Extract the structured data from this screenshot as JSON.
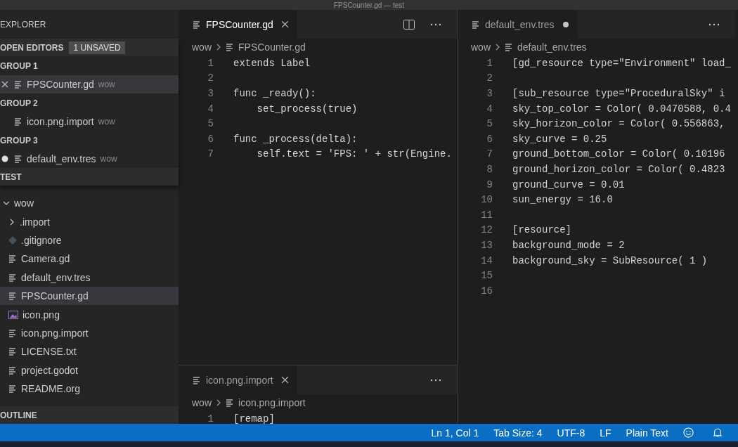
{
  "window": {
    "title": "FPSCounter.gd — test"
  },
  "sidebar": {
    "title": "EXPLORER",
    "open_editors": {
      "title": "OPEN EDITORS",
      "badge": "1 UNSAVED",
      "groups": [
        {
          "title": "GROUP 1",
          "items": [
            {
              "name": "FPSCounter.gd",
              "folder": "wow",
              "close_shown": true,
              "dirty": false,
              "selected": true
            }
          ]
        },
        {
          "title": "GROUP 2",
          "items": [
            {
              "name": "icon.png.import",
              "folder": "wow",
              "close_shown": false,
              "dirty": false,
              "selected": false
            }
          ]
        },
        {
          "title": "GROUP 3",
          "items": [
            {
              "name": "default_env.tres",
              "folder": "wow",
              "close_shown": false,
              "dirty": true,
              "selected": false
            }
          ]
        }
      ]
    },
    "folder_title": "TEST",
    "tree": [
      {
        "name": "wow",
        "kind": "folder",
        "expanded": true,
        "selected": false,
        "children": [
          {
            "name": ".import",
            "kind": "folder",
            "expanded": false,
            "selected": false
          },
          {
            "name": ".gitignore",
            "kind": "git",
            "selected": false
          },
          {
            "name": "Camera.gd",
            "kind": "file",
            "selected": false
          },
          {
            "name": "default_env.tres",
            "kind": "file",
            "selected": false
          },
          {
            "name": "FPSCounter.gd",
            "kind": "file",
            "selected": true
          },
          {
            "name": "icon.png",
            "kind": "image",
            "selected": false
          },
          {
            "name": "icon.png.import",
            "kind": "file",
            "selected": false
          },
          {
            "name": "LICENSE.txt",
            "kind": "file",
            "selected": false
          },
          {
            "name": "project.godot",
            "kind": "file",
            "selected": false
          },
          {
            "name": "README.org",
            "kind": "file",
            "selected": false
          }
        ]
      }
    ],
    "outline_title": "OUTLINE"
  },
  "editors": [
    {
      "tab": {
        "label": "FPSCounter.gd",
        "dirty": false,
        "focused": true
      },
      "split_button": true,
      "breadcrumb": [
        "wow",
        "FPSCounter.gd"
      ],
      "lines": [
        {
          "number": "1",
          "text": "extends Label"
        },
        {
          "number": "2"
        },
        {
          "number": "3",
          "text": "func _ready():"
        },
        {
          "number": "4",
          "text": "    set_process(true)"
        },
        {
          "number": "5"
        },
        {
          "number": "6",
          "text": "func _process(delta):"
        },
        {
          "number": "7",
          "text": "    self.text = 'FPS: ' + str(Engine."
        }
      ]
    },
    {
      "tab": {
        "label": "icon.png.import",
        "dirty": false,
        "focused": false
      },
      "split_button": false,
      "breadcrumb": [
        "wow",
        "icon.png.import"
      ],
      "lines": [
        {
          "number": "1",
          "text": "[remap]"
        }
      ]
    },
    {
      "tab": {
        "label": "default_env.tres",
        "dirty": true,
        "focused": false
      },
      "split_button": false,
      "breadcrumb": [
        "wow",
        "default_env.tres"
      ],
      "lines": [
        {
          "number": "1",
          "text": "[gd_resource type=\"Environment\" load_"
        },
        {
          "number": "2"
        },
        {
          "number": "3",
          "text": "[sub_resource type=\"ProceduralSky\" i"
        },
        {
          "number": "4",
          "text": "sky_top_color = Color( 0.0470588, 0.4"
        },
        {
          "number": "5",
          "text": "sky_horizon_color = Color( 0.556863,"
        },
        {
          "number": "6",
          "text": "sky_curve = 0.25"
        },
        {
          "number": "7",
          "text": "ground_bottom_color = Color( 0.10196"
        },
        {
          "number": "8",
          "text": "ground_horizon_color = Color( 0.4823"
        },
        {
          "number": "9",
          "text": "ground_curve = 0.01"
        },
        {
          "number": "10",
          "text": "sun_energy = 16.0"
        },
        {
          "number": "11"
        },
        {
          "number": "12",
          "text": "[resource]"
        },
        {
          "number": "13",
          "text": "background_mode = 2"
        },
        {
          "number": "14",
          "text": "background_sky = SubResource( 1 )"
        },
        {
          "number": "15"
        },
        {
          "number": "16"
        }
      ]
    }
  ],
  "status_bar": {
    "items": [
      "Ln 1, Col 1",
      "Tab Size: 4",
      "UTF-8",
      "LF",
      "Plain Text"
    ]
  }
}
